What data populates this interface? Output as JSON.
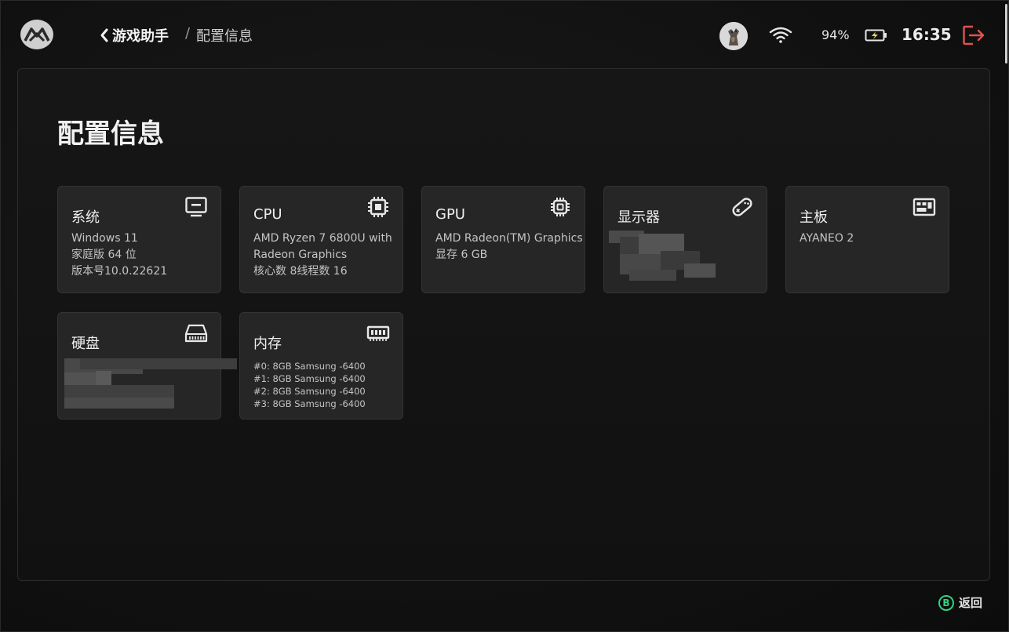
{
  "header": {
    "back_label": "游戏助手",
    "crumb_separator": "/",
    "crumb_current": "配置信息",
    "battery_percent": "94%",
    "time": "16:35"
  },
  "page": {
    "title": "配置信息"
  },
  "cards": {
    "system": {
      "title": "系统",
      "lines": [
        "Windows 11",
        "家庭版 64 位",
        "版本号10.0.22621"
      ],
      "icon": "monitor-icon"
    },
    "cpu": {
      "title": "CPU",
      "lines": [
        "AMD Ryzen 7 6800U with",
        "Radeon Graphics",
        "核心数 8线程数 16"
      ],
      "icon": "cpu-chip-icon"
    },
    "gpu": {
      "title": "GPU",
      "lines": [
        "AMD Radeon(TM) Graphics",
        "显存 6 GB"
      ],
      "icon": "gpu-chip-icon"
    },
    "display": {
      "title": "显示器",
      "lines": [],
      "icon": "handheld-console-icon"
    },
    "motherboard": {
      "title": "主板",
      "lines": [
        "AYANEO 2"
      ],
      "icon": "motherboard-icon"
    },
    "disk": {
      "title": "硬盘",
      "lines": [],
      "icon": "hard-drive-icon"
    },
    "memory": {
      "title": "内存",
      "lines": [
        "#0: 8GB Samsung -6400",
        "#1: 8GB Samsung -6400",
        "#2: 8GB Samsung -6400",
        "#3: 8GB Samsung -6400"
      ],
      "icon": "memory-module-icon"
    }
  },
  "footer": {
    "button_glyph": "B",
    "label": "返回"
  },
  "colors": {
    "accent_green": "#2fd27f",
    "exit_red": "#e0524f",
    "battery_yellow": "#f2d64b"
  }
}
